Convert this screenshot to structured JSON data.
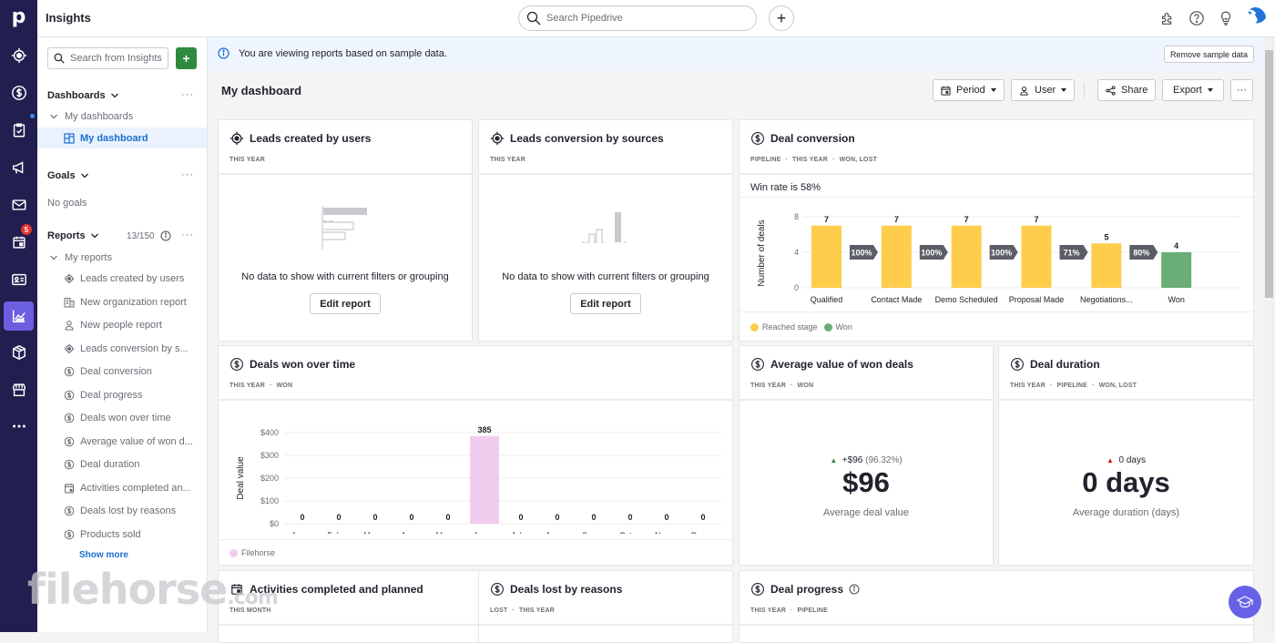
{
  "app": {
    "title": "Insights"
  },
  "topbar": {
    "search_placeholder": "Search Pipedrive",
    "add_icon": "plus-icon",
    "icons": [
      "puzzle-icon",
      "help-icon",
      "lightbulb-icon",
      "avatar"
    ]
  },
  "rail": {
    "items": [
      {
        "name": "leads",
        "icon": "target-icon"
      },
      {
        "name": "deals",
        "icon": "dollar-icon"
      },
      {
        "name": "projects",
        "icon": "clipboard-icon",
        "dot": true
      },
      {
        "name": "campaigns",
        "icon": "megaphone-icon"
      },
      {
        "name": "mail",
        "icon": "mail-icon"
      },
      {
        "name": "activities",
        "icon": "calendar-icon",
        "badge": "5"
      },
      {
        "name": "contacts",
        "icon": "contact-card-icon"
      },
      {
        "name": "insights",
        "icon": "chart-icon",
        "active": true
      },
      {
        "name": "products",
        "icon": "box-icon"
      },
      {
        "name": "marketplace",
        "icon": "store-icon"
      },
      {
        "name": "more",
        "icon": "more-icon"
      }
    ]
  },
  "sidebar": {
    "search_placeholder": "Search from Insights",
    "add_label": "+",
    "dashboards": {
      "label": "Dashboards",
      "group": "My dashboards",
      "items": [
        {
          "label": "My dashboard",
          "active": true
        }
      ]
    },
    "goals": {
      "label": "Goals",
      "empty": "No goals"
    },
    "reports": {
      "label": "Reports",
      "count": "13/150",
      "group": "My reports",
      "items": [
        {
          "label": "Leads created by users",
          "icon": "target-icon"
        },
        {
          "label": "New organization report",
          "icon": "building-icon"
        },
        {
          "label": "New people report",
          "icon": "person-icon"
        },
        {
          "label": "Leads conversion by s...",
          "icon": "target-icon"
        },
        {
          "label": "Deal conversion",
          "icon": "dollar-icon"
        },
        {
          "label": "Deal progress",
          "icon": "dollar-icon"
        },
        {
          "label": "Deals won over time",
          "icon": "dollar-icon"
        },
        {
          "label": "Average value of won d...",
          "icon": "dollar-icon"
        },
        {
          "label": "Deal duration",
          "icon": "dollar-icon"
        },
        {
          "label": "Activities completed an...",
          "icon": "calendar-icon"
        },
        {
          "label": "Deals lost by reasons",
          "icon": "dollar-icon"
        },
        {
          "label": "Products sold",
          "icon": "dollar-icon"
        }
      ],
      "show_more": "Show more"
    }
  },
  "banner": {
    "text": "You are viewing reports based on sample data.",
    "remove_label": "Remove sample data"
  },
  "dashboard": {
    "title": "My dashboard",
    "period_label": "Period",
    "user_label": "User",
    "share_label": "Share",
    "export_label": "Export"
  },
  "cards": {
    "leads_by_users": {
      "title": "Leads created by users",
      "meta": [
        "THIS YEAR"
      ],
      "empty_text": "No data to show with current filters or grouping",
      "edit_label": "Edit report"
    },
    "leads_by_sources": {
      "title": "Leads conversion by sources",
      "meta": [
        "THIS YEAR"
      ],
      "empty_text": "No data to show with current filters or grouping",
      "edit_label": "Edit report"
    },
    "deal_conversion": {
      "title": "Deal conversion",
      "meta": [
        "PIPELINE",
        "THIS YEAR",
        "WON, LOST"
      ],
      "win_rate": "Win rate is 58%",
      "legend": [
        {
          "label": "Reached stage",
          "color": "#fecd4b"
        },
        {
          "label": "Won",
          "color": "#6aad76"
        }
      ]
    },
    "deals_won_over_time": {
      "title": "Deals won over time",
      "meta": [
        "THIS YEAR",
        "WON"
      ],
      "legend": [
        {
          "label": "Filehorse",
          "color": "#f0cdee"
        }
      ]
    },
    "avg_value": {
      "title": "Average value of won deals",
      "meta": [
        "THIS YEAR",
        "WON"
      ],
      "delta": "+$96",
      "delta_pct": "(96.32%)",
      "value": "$96",
      "label": "Average deal value",
      "delta_color": "#2f8a3f"
    },
    "deal_duration": {
      "title": "Deal duration",
      "meta": [
        "THIS YEAR",
        "PIPELINE",
        "WON, LOST"
      ],
      "delta": "0 days",
      "value": "0 days",
      "label": "Average duration (days)",
      "delta_color": "#d11a1a"
    },
    "activities": {
      "title": "Activities completed and planned",
      "meta": [
        "THIS MONTH"
      ]
    },
    "deals_lost": {
      "title": "Deals lost by reasons",
      "meta": [
        "LOST",
        "THIS YEAR"
      ]
    },
    "deal_progress": {
      "title": "Deal progress",
      "meta": [
        "THIS YEAR",
        "PIPELINE"
      ]
    }
  },
  "chart_data": [
    {
      "id": "deal_conversion",
      "type": "bar",
      "title": "Deal conversion",
      "xlabel": "",
      "ylabel": "Number of deals",
      "ylim": [
        0,
        8
      ],
      "yticks": [
        0,
        4,
        8
      ],
      "grid": true,
      "categories": [
        "Qualified",
        "Contact Made",
        "Demo Scheduled",
        "Proposal Made",
        "Negotiations...",
        "Won"
      ],
      "values": [
        7,
        7,
        7,
        7,
        5,
        4
      ],
      "series_kind": [
        "reached",
        "reached",
        "reached",
        "reached",
        "reached",
        "won"
      ],
      "conversion_rates": [
        "100%",
        "100%",
        "100%",
        "71%",
        "80%"
      ],
      "legend": [
        "Reached stage",
        "Won"
      ],
      "legend_position": "bottom-left"
    },
    {
      "id": "deals_won_over_time",
      "type": "bar",
      "title": "Deals won over time",
      "xlabel": "",
      "ylabel": "Deal value",
      "ylim": [
        0,
        400
      ],
      "yticks": [
        "$0",
        "$100",
        "$200",
        "$300",
        "$400"
      ],
      "grid": true,
      "categories": [
        "Jan ...",
        "Feb ...",
        "Mar ...",
        "Apr ...",
        "May ...",
        "Jun ...",
        "Jul ...",
        "Aug ...",
        "Sep ...",
        "Oct ...",
        "Nov ...",
        "Dec ..."
      ],
      "series": [
        {
          "name": "Filehorse",
          "values": [
            0,
            0,
            0,
            0,
            0,
            385,
            0,
            0,
            0,
            0,
            0,
            0
          ]
        }
      ],
      "legend_position": "bottom-left"
    }
  ],
  "watermark": {
    "text": "filehorse",
    "suffix": ".com"
  }
}
